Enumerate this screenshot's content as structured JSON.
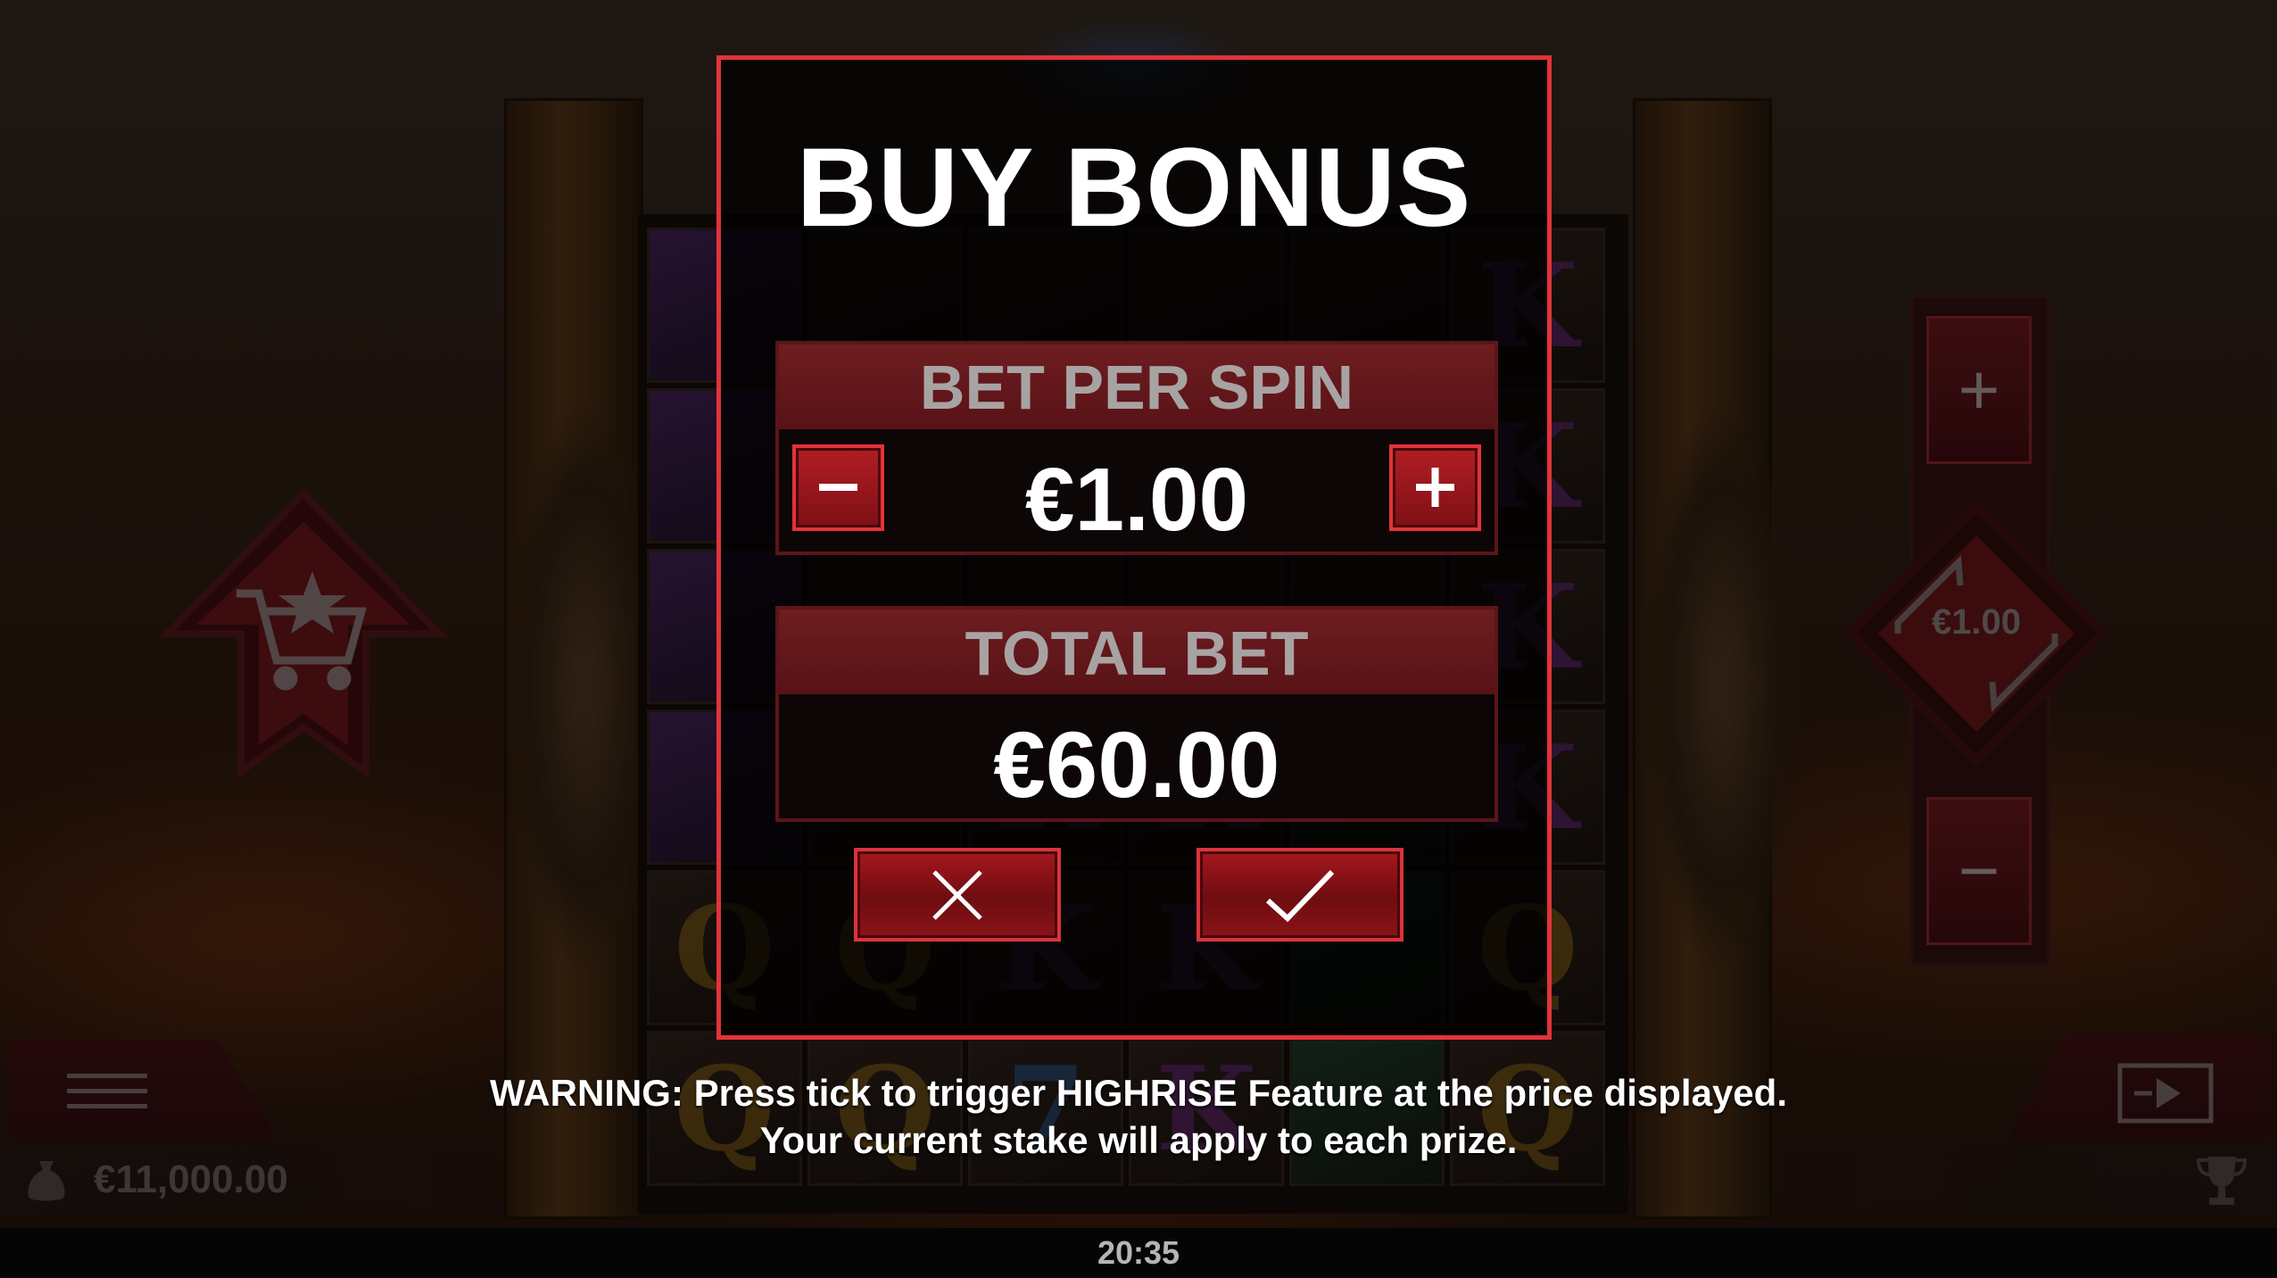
{
  "modal": {
    "title": "BUY BONUS",
    "bet_per_spin_label": "BET PER SPIN",
    "bet_per_spin_value": "€1.00",
    "total_bet_label": "TOTAL BET",
    "total_bet_value": "€60.00",
    "minus_icon": "minus-icon",
    "plus_icon": "plus-icon",
    "cancel_icon": "close-icon",
    "confirm_icon": "checkmark-icon"
  },
  "warning": {
    "line1": "WARNING: Press tick to trigger HIGHRISE Feature at the price displayed.",
    "line2": "Your current stake will apply to each prize."
  },
  "hud": {
    "balance": "€11,000.00",
    "bet_display": "€1.00",
    "bet_plus": "+",
    "bet_minus": "−"
  },
  "statusbar": {
    "time": "20:35"
  },
  "colors": {
    "accent": "#e2333a",
    "panel_header": "#6e1d20",
    "button_red": "#a5171d"
  }
}
